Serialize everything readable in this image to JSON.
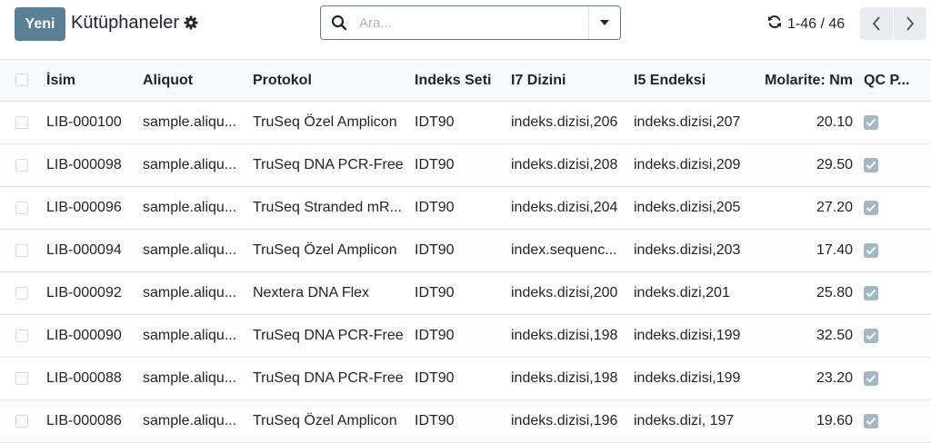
{
  "toolbar": {
    "new_label": "Yeni",
    "title": "Kütüphaneler",
    "gear_icon": "gear-icon"
  },
  "search": {
    "placeholder": "Ara...",
    "value": ""
  },
  "pager": {
    "range": "1-46 / 46"
  },
  "table": {
    "columns": [
      "İsim",
      "Aliquot",
      "Protokol",
      "Indeks Seti",
      "I7 Dizini",
      "I5 Endeksi",
      "Molarite: Nm",
      "QC P..."
    ],
    "rows": [
      {
        "name": "LIB-000100",
        "aliquot": "sample.aliqu...",
        "protocol": "TruSeq Özel Amplicon",
        "index_set": "IDT90",
        "i7": "indeks.dizisi,206",
        "i5": "indeks.dizisi,207",
        "molarity": "20.10",
        "qc": true
      },
      {
        "name": "LIB-000098",
        "aliquot": "sample.aliqu...",
        "protocol": "TruSeq DNA PCR-Free",
        "index_set": "IDT90",
        "i7": "indeks.dizisi,208",
        "i5": "indeks.dizisi,209",
        "molarity": "29.50",
        "qc": true
      },
      {
        "name": "LIB-000096",
        "aliquot": "sample.aliqu...",
        "protocol": "TruSeq Stranded mR...",
        "index_set": "IDT90",
        "i7": "indeks.dizisi,204",
        "i5": "indeks.dizisi,205",
        "molarity": "27.20",
        "qc": true
      },
      {
        "name": "LIB-000094",
        "aliquot": "sample.aliqu...",
        "protocol": "TruSeq Özel Amplicon",
        "index_set": "IDT90",
        "i7": "index.sequenc...",
        "i5": "indeks.dizisi,203",
        "molarity": "17.40",
        "qc": true
      },
      {
        "name": "LIB-000092",
        "aliquot": "sample.aliqu...",
        "protocol": "Nextera DNA Flex",
        "index_set": "IDT90",
        "i7": "indeks.dizisi,200",
        "i5": "indeks.dizi,201",
        "molarity": "25.80",
        "qc": true
      },
      {
        "name": "LIB-000090",
        "aliquot": "sample.aliqu...",
        "protocol": "TruSeq DNA PCR-Free",
        "index_set": "IDT90",
        "i7": "indeks.dizisi,198",
        "i5": "indeks.dizisi,199",
        "molarity": "32.50",
        "qc": true
      },
      {
        "name": "LIB-000088",
        "aliquot": "sample.aliqu...",
        "protocol": "TruSeq DNA PCR-Free",
        "index_set": "IDT90",
        "i7": "indeks.dizisi,198",
        "i5": "indeks.dizisi,199",
        "molarity": "23.20",
        "qc": true
      },
      {
        "name": "LIB-000086",
        "aliquot": "sample.aliqu...",
        "protocol": "TruSeq Özel Amplicon",
        "index_set": "IDT90",
        "i7": "indeks.dizisi,196",
        "i5": "indeks.dizi, 197",
        "molarity": "19.60",
        "qc": true
      }
    ]
  },
  "colors": {
    "primary": "#5b7f95",
    "qc_checked": "#a3b8c6"
  }
}
